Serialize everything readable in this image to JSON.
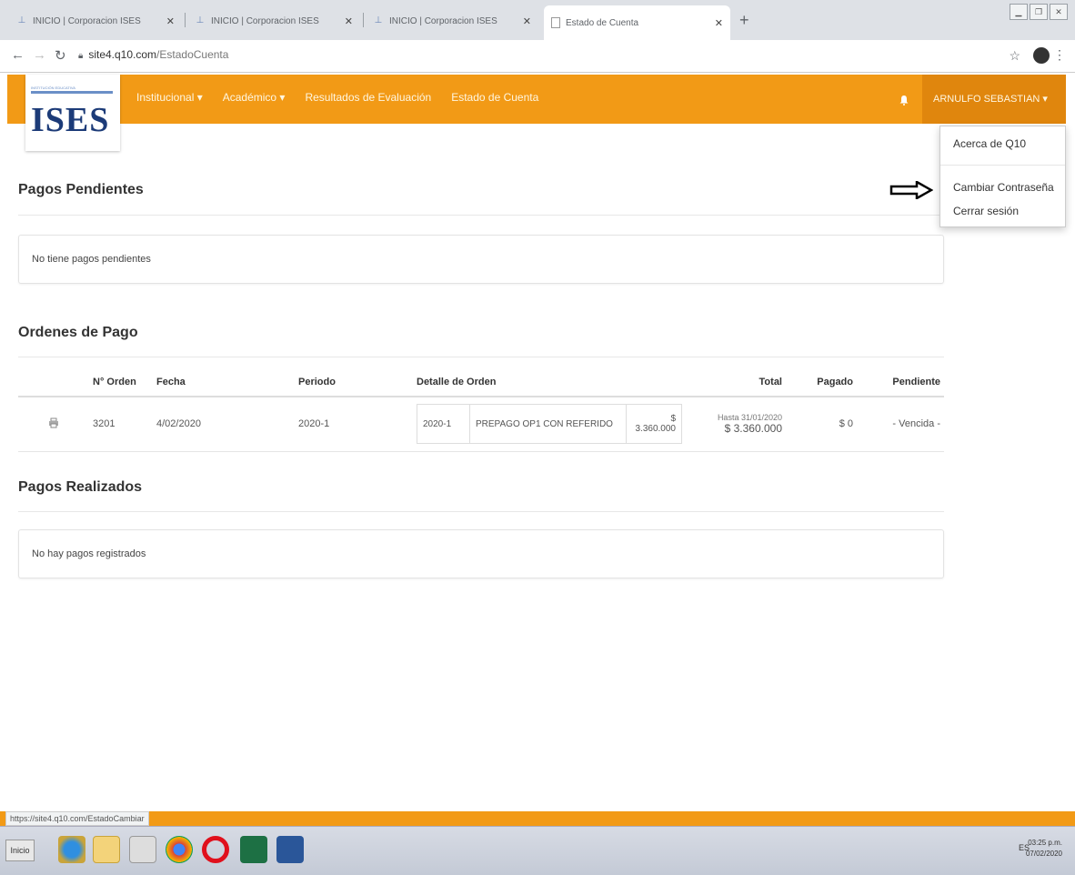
{
  "browser": {
    "tabs": [
      {
        "title": "INICIO | Corporacion ISES",
        "close": "✕"
      },
      {
        "title": "INICIO | Corporacion ISES",
        "close": "✕"
      },
      {
        "title": "INICIO | Corporacion ISES",
        "close": "✕"
      },
      {
        "title": "Estado de Cuenta",
        "close": "✕"
      }
    ],
    "new_tab": "+",
    "url_host": "site4.q10.com",
    "url_path": "/EstadoCuenta",
    "status_url": "https://site4.q10.com/EstadoCambiar"
  },
  "site": {
    "logo_text": "ISES",
    "logo_tagline": "INSTITUCIÓN EDUCATIVA",
    "nav": [
      "Institucional ▾",
      "Académico ▾",
      "Resultados de Evaluación",
      "Estado de Cuenta"
    ],
    "user": "ARNULFO SEBASTIAN ▾",
    "user_menu": [
      "Acerca de Q10",
      "Cambiar Contraseña",
      "Cerrar sesión"
    ],
    "brand_color": "#f29a16"
  },
  "pagos_pendientes": {
    "title": "Pagos Pendientes",
    "empty": "No tiene pagos pendientes"
  },
  "ordenes": {
    "title": "Ordenes de Pago",
    "headers": [
      "",
      "N° Orden",
      "Fecha",
      "Periodo",
      "Detalle de Orden",
      "Total",
      "Pagado",
      "Pendiente"
    ],
    "rows": [
      {
        "orden": "3201",
        "fecha": "4/02/2020",
        "periodo": "2020-1",
        "detalle_periodo": "2020-1",
        "detalle_desc": "PREPAGO OP1 CON REFERIDO",
        "detalle_valor_symbol": "$",
        "detalle_valor": "3.360.000",
        "hasta": "Hasta 31/01/2020",
        "total": "$ 3.360.000",
        "pagado": "$ 0",
        "pendiente": "- Vencida -"
      }
    ]
  },
  "pagos_realizados": {
    "title": "Pagos Realizados",
    "empty": "No hay pagos registrados"
  },
  "taskbar": {
    "start": "Inicio",
    "lang": "ES",
    "time": "03:25 p.m.",
    "date": "07/02/2020"
  }
}
